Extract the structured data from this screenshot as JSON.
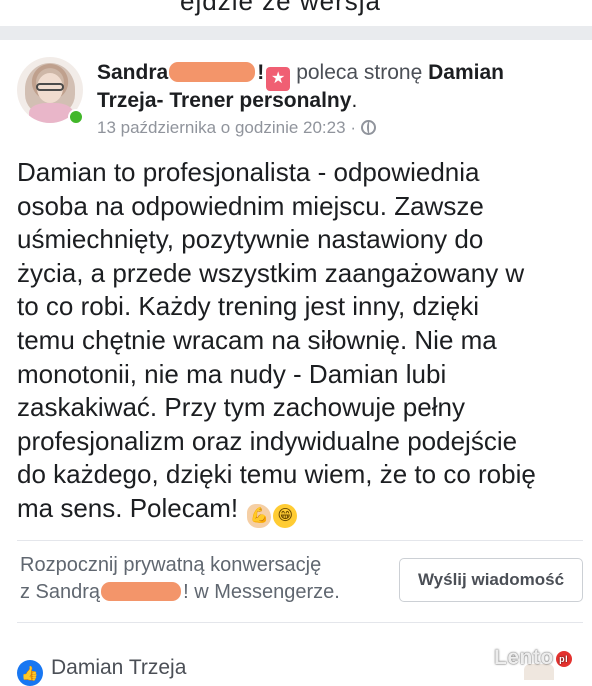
{
  "top_cutoff_text": "ejdzie że wersja",
  "post": {
    "author_name": "Sandra",
    "recommends_text": "poleca stronę",
    "page_name_line1": "Damian",
    "page_name_line2": "Trzeja- Trener personalny",
    "period": ".",
    "timestamp": "13 października o godzinie 20:23",
    "privacy_separator": "·",
    "privacy_icon": "globe-icon",
    "recommend_icon": "recommendation-star-icon",
    "review_lines": [
      "Damian to profesjonalista - odpowiednia",
      "osoba na odpowiednim miejscu. Zawsze",
      "uśmiechnięty, pozytywnie nastawiony do",
      "życia, a przede wszystkim zaangażowany w",
      "to co robi. Każdy trening jest inny, dzięki",
      "temu chętnie wracam na siłownię. Nie ma",
      "monotonii, nie ma nudy - Damian lubi",
      "zaskakiwać. Przy tym zachowuje pełny",
      "profesjonalizm oraz indywidualne podejście",
      "do każdego, dzięki temu wiem, że to co robię",
      "ma sens. Polecam!"
    ],
    "emoji": [
      "flexed-biceps-icon",
      "grinning-face-icon"
    ]
  },
  "messenger": {
    "line1": "Rozpocznij prywatną konwersację",
    "line2_prefix": "z Sandrą",
    "line2_suffix": "w Messengerze.",
    "button_label": "Wyślij wiadomość"
  },
  "footer": {
    "name": "Damian Trzeja",
    "icon": "like-icon"
  },
  "watermark": {
    "text": "Lento",
    "badge": "pl"
  },
  "colors": {
    "redaction": "#f3956a",
    "online": "#42b72a",
    "facebook_blue": "#1877f2",
    "recommend_red": "#f05f73"
  }
}
